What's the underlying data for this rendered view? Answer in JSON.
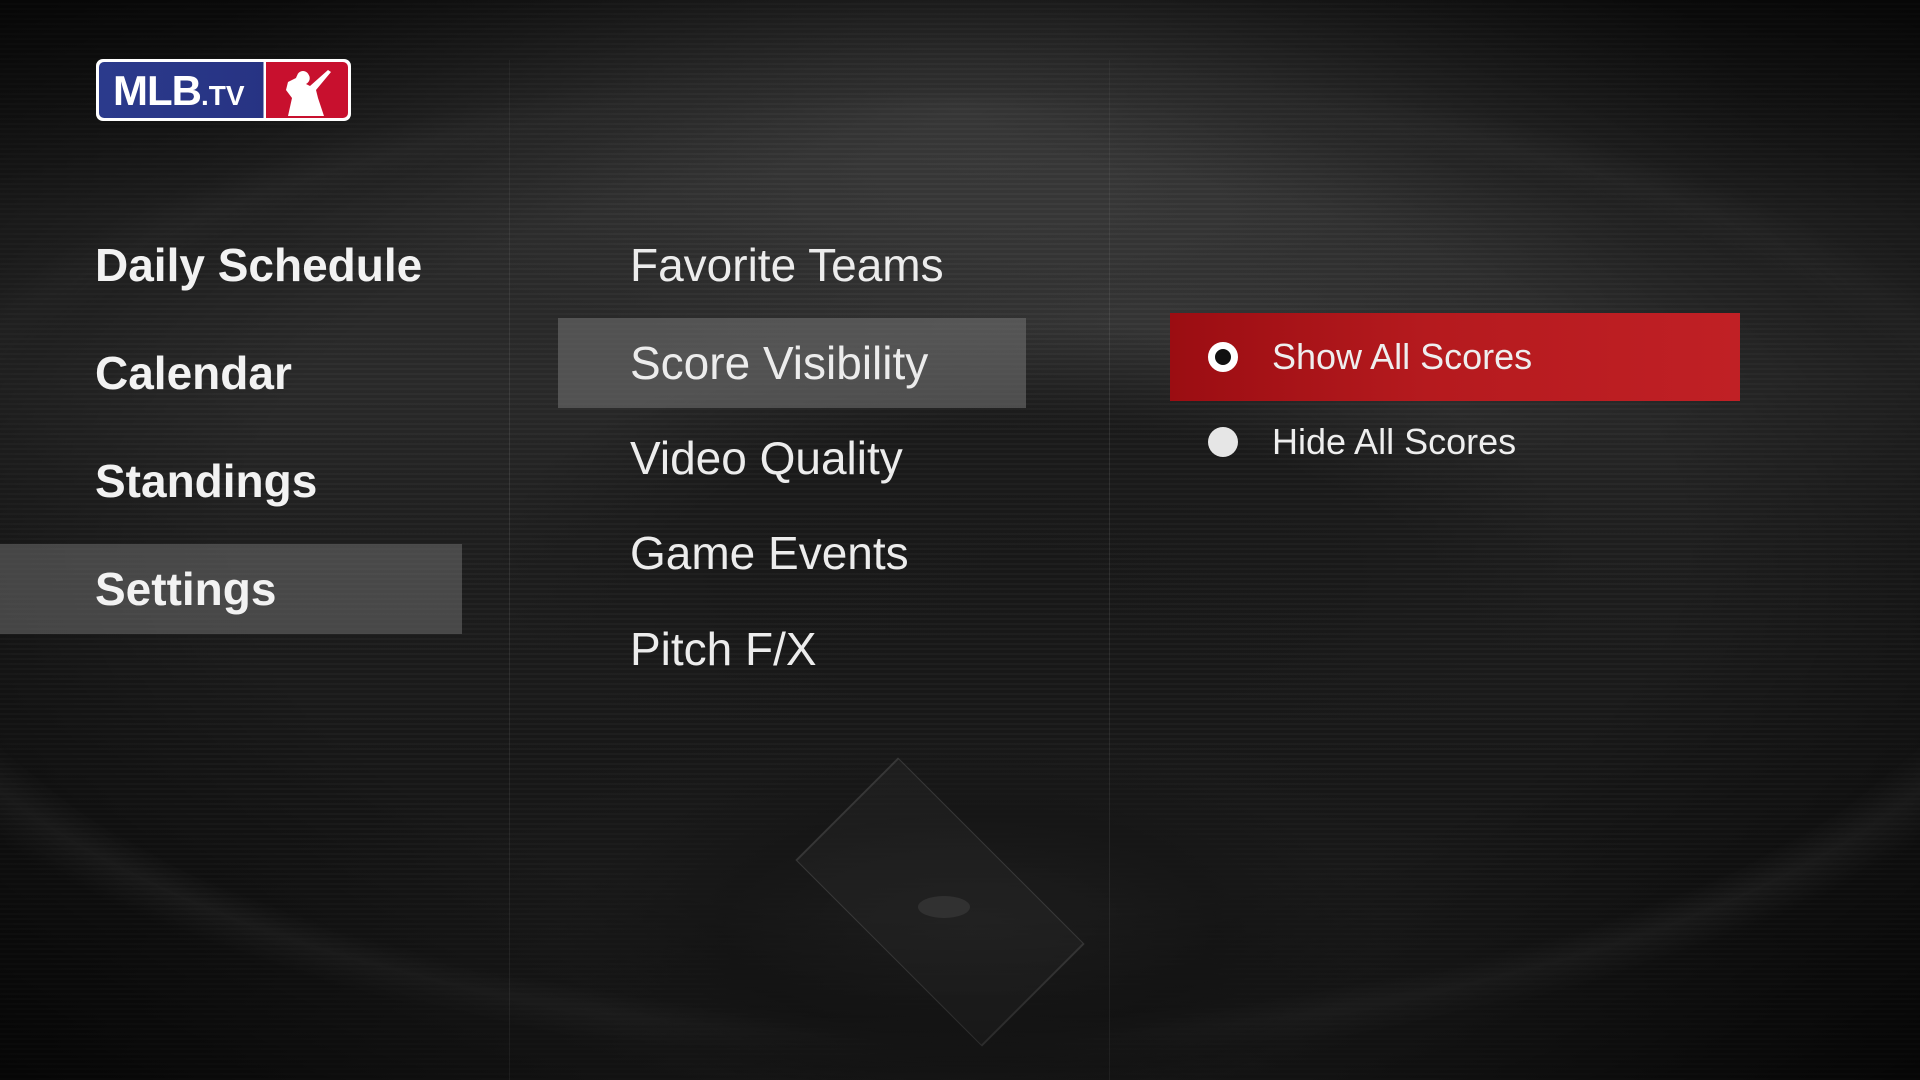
{
  "app": {
    "logo_text": "MLB",
    "logo_suffix": ".TV"
  },
  "nav": {
    "items": [
      {
        "label": "Daily Schedule",
        "active": false
      },
      {
        "label": "Calendar",
        "active": false
      },
      {
        "label": "Standings",
        "active": false
      },
      {
        "label": "Settings",
        "active": true
      }
    ]
  },
  "settings_menu": {
    "items": [
      {
        "label": "Favorite Teams",
        "active": false
      },
      {
        "label": "Score Visibility",
        "active": true
      },
      {
        "label": "Video Quality",
        "active": false
      },
      {
        "label": "Game Events",
        "active": false
      },
      {
        "label": "Pitch F/X",
        "active": false
      }
    ]
  },
  "score_visibility": {
    "options": [
      {
        "label": "Show All Scores",
        "selected": true,
        "focused": true
      },
      {
        "label": "Hide All Scores",
        "selected": false,
        "focused": false
      }
    ]
  },
  "colors": {
    "accent_red": "#b51a1e",
    "logo_blue": "#273383",
    "logo_red": "#c8102e",
    "highlight_gray": "#6e6e6e"
  },
  "icons": {
    "selected_radio": "radio-selected-icon",
    "unselected_radio": "radio-unselected-icon",
    "logo_batter": "batter-silhouette-icon"
  }
}
